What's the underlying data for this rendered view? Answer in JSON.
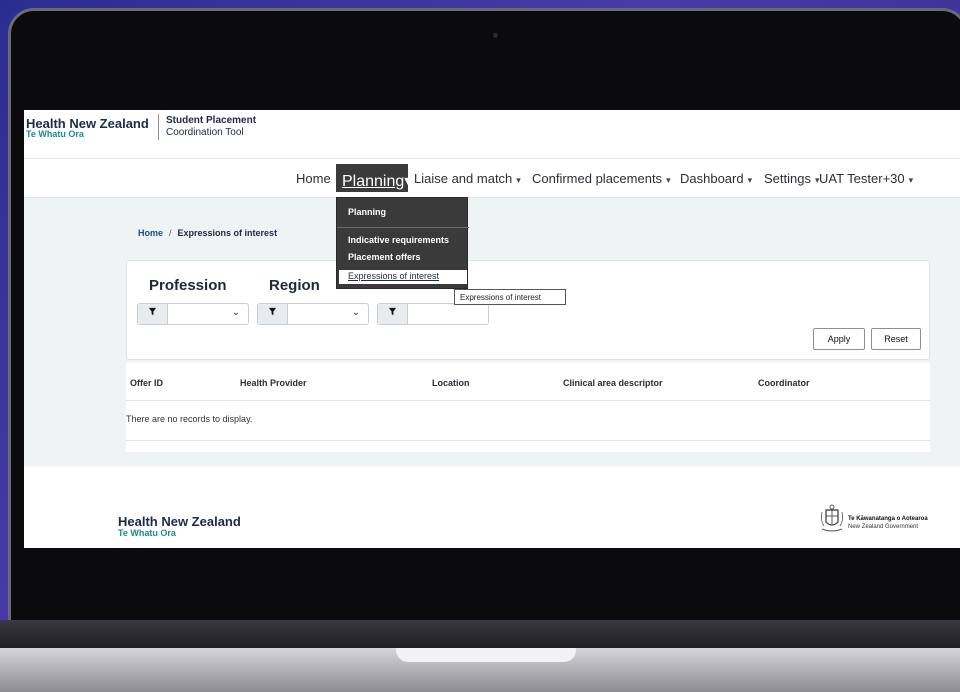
{
  "brand": {
    "name": "Health New Zealand",
    "maori_name": "Te Whatu Ora",
    "tool_line1": "Student Placement",
    "tool_line2": "Coordination Tool"
  },
  "nav": {
    "items": [
      {
        "label": "Home"
      },
      {
        "label": "Planning",
        "active": true
      },
      {
        "label": "Liaise and match"
      },
      {
        "label": "Confirmed placements"
      },
      {
        "label": "Dashboard"
      },
      {
        "label": "Settings"
      },
      {
        "label": "UAT Tester+30"
      }
    ],
    "caret_glyph": "▾"
  },
  "planning_menu": {
    "header": "Planning",
    "items": [
      {
        "label": "Indicative requirements"
      },
      {
        "label": "Placement offers"
      },
      {
        "label": "Expressions of interest",
        "hovered": true
      }
    ]
  },
  "tooltip": "Expressions of interest",
  "breadcrumb": {
    "home": "Home",
    "separator": "/",
    "current": "Expressions of interest"
  },
  "filters": {
    "profession_label": "Profession",
    "region_label": "Region",
    "apply_label": "Apply",
    "reset_label": "Reset"
  },
  "table": {
    "columns": [
      "Offer ID",
      "Health Provider",
      "Location",
      "Clinical area descriptor",
      "Coordinator"
    ],
    "empty_message": "There are no records to display."
  },
  "footer": {
    "name": "Health New Zealand",
    "maori_name": "Te Whatu Ora",
    "gov_line1": "Te Kāwanatanga o Aotearoa",
    "gov_line2": "New Zealand Government"
  },
  "colors": {
    "nav_active_bg": "#3a3a3a",
    "brand_navy": "#1b2a4a",
    "brand_teal": "#1a8a8a",
    "content_bg": "#eef3f3"
  }
}
